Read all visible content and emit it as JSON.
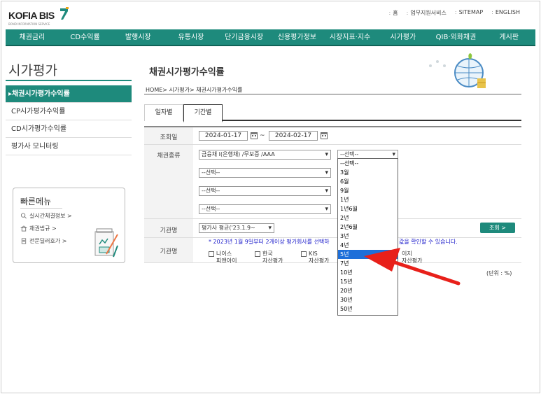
{
  "logo": {
    "text": "KOFIA BIS",
    "sub": "BOND INFORMATION SERVICE"
  },
  "toplinks": [
    "홈",
    "업무지원서비스",
    "SITEMAP",
    "ENGLISH"
  ],
  "gnb": [
    "채권금리",
    "CD수익률",
    "발행시장",
    "유통시장",
    "단기금융시장",
    "신용평가정보",
    "시장지표·지수",
    "시가평가",
    "QIB·외화채권",
    "게시판"
  ],
  "lnb": {
    "title": "시가평가",
    "items": [
      "채권시가평가수익률",
      "CP시가평가수익률",
      "CD시가평가수익률",
      "평가사 모니터링"
    ]
  },
  "quick": {
    "title": "빠른메뉴",
    "items": [
      "실시간체결정보 >",
      "채권법규 >",
      "전문딜러호가 >"
    ]
  },
  "page": {
    "title": "채권시가평가수익률",
    "breadcrumb": "HOME> 시가평가> 채권시가평가수익률"
  },
  "tabs": [
    "일자별",
    "기간별"
  ],
  "form": {
    "date_label": "조회일",
    "date_from": "2024-01-17",
    "date_sep": "~",
    "date_to": "2024-02-17",
    "bond_label": "채권종류",
    "bond_type": "금융채 I(은행채) /무보증 /AAA",
    "select_placeholder": "--선택--",
    "agency_label": "기관명",
    "agency_value": "평가사 평균('23.1.9~",
    "agency2_label": "기관명",
    "search_btn": "조회 >",
    "notice": "* 2023년 1월 9일부터 2개이상 평가회사를 선택하",
    "notice_tail": "값을 확인할 수 있습니다.",
    "checkboxes": [
      {
        "l1": "나이스",
        "l2": "피앤아이"
      },
      {
        "l1": "한국",
        "l2": "자산평가"
      },
      {
        "l1": "KIS",
        "l2": "자산평가"
      }
    ],
    "cb_extra": {
      "l1": "이지",
      "l2": "자산평가"
    },
    "unit": "(단위 : %)"
  },
  "dropdown": {
    "options": [
      "--선택--",
      "3월",
      "6월",
      "9월",
      "1년",
      "1년6월",
      "2년",
      "2년6월",
      "3년",
      "4년",
      "5년",
      "7년",
      "10년",
      "15년",
      "20년",
      "30년",
      "50년"
    ],
    "highlighted": "5년"
  },
  "colors": {
    "brand": "#1e8a7c",
    "highlight": "#1e6fd9",
    "arrow": "#e8201a"
  }
}
